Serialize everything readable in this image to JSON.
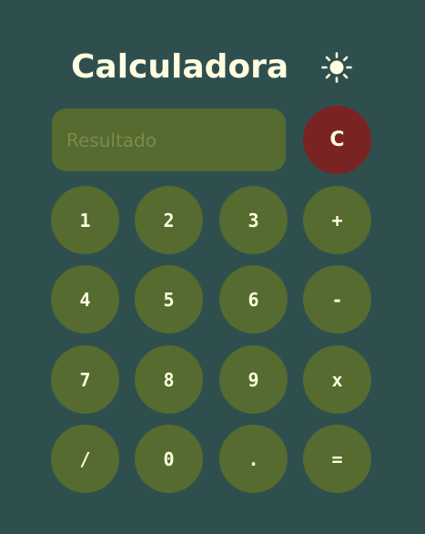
{
  "app": {
    "title": "Calculadora",
    "theme_icon": "sun-icon"
  },
  "display": {
    "placeholder": "Resultado",
    "value": ""
  },
  "buttons": {
    "clear": "C",
    "one": "1",
    "two": "2",
    "three": "3",
    "plus": "+",
    "four": "4",
    "five": "5",
    "six": "6",
    "minus": "-",
    "seven": "7",
    "eight": "8",
    "nine": "9",
    "multiply": "x",
    "divide": "/",
    "zero": "0",
    "dot": ".",
    "equals": "="
  },
  "colors": {
    "background": "#2f4f4f",
    "button": "#556b2f",
    "clear_button": "#7a2323",
    "text": "#fffde0"
  }
}
